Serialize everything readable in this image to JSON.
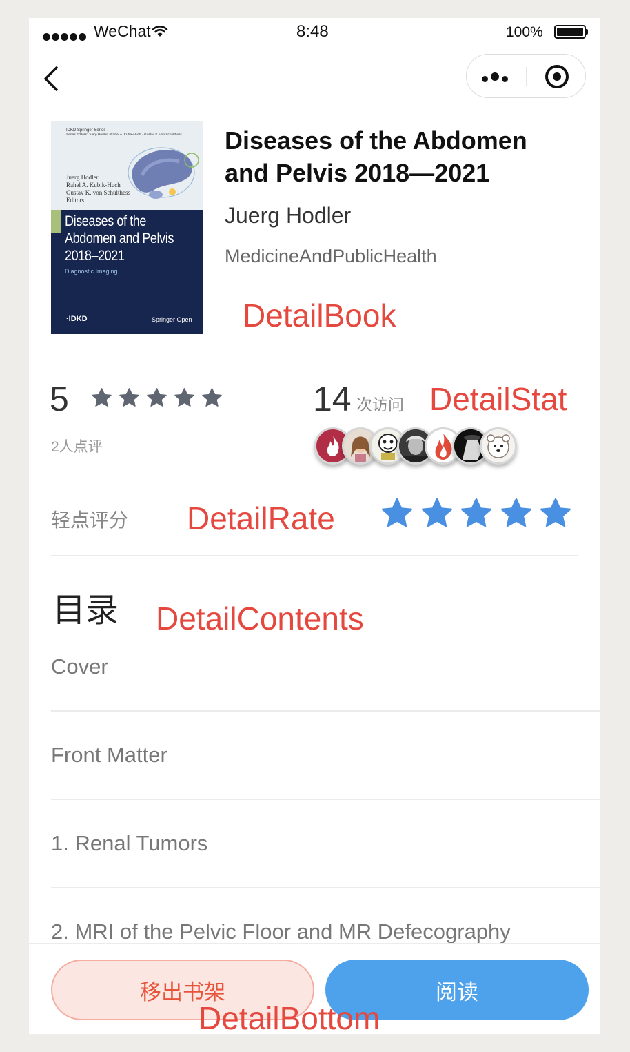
{
  "status_bar": {
    "carrier": "WeChat",
    "time": "8:48",
    "battery_percent": "100%"
  },
  "book": {
    "title_line1": "Diseases of the Abdomen",
    "title_line2": "and Pelvis 2018—2021",
    "author": "Juerg Hodler",
    "category": "MedicineAndPublicHealth",
    "cover": {
      "series": "IDKD Springer Series",
      "series_editors": "Series Editors: Juerg Hodler · Rahel A. Kubik-Huch · Gustav K. von Schulthess",
      "editors": [
        "Juerg Hodler",
        "Rahel A. Kubik-Huch",
        "Gustav K. von Schulthess",
        "Editors"
      ],
      "title_lines": [
        "Diseases of the",
        "Abdomen and Pelvis",
        "2018–2021"
      ],
      "subtitle": "Diagnostic Imaging",
      "badge": "·IDKD",
      "publisher": "Springer Open"
    }
  },
  "stat": {
    "score": "5",
    "rating_stars": 5,
    "reviewers": "2人点评",
    "visits": "14",
    "visits_label": "次访问",
    "avatar_count": 7
  },
  "rate": {
    "label": "轻点评分",
    "selected_stars": 5,
    "star_color": "#4a90e2"
  },
  "contents": {
    "title": "目录",
    "items": [
      "Cover",
      "Front Matter",
      "1. Renal Tumors",
      "2. MRI of the Pelvic Floor and MR Defecography"
    ]
  },
  "bottom": {
    "remove_label": "移出书架",
    "read_label": "阅读"
  },
  "annotations": {
    "book": "DetailBook",
    "stat": "DetailStat",
    "rate": "DetailRate",
    "contents": "DetailContents",
    "bottom": "DetailBottom"
  },
  "colors": {
    "annotation": "#e5483e",
    "read_button": "#4ea2ec",
    "remove_button_bg": "#fbe6e2",
    "remove_button_text": "#e8543b",
    "gray_star": "#5f6672",
    "cover_bg": "#17264e"
  },
  "icons": [
    "back-arrow-icon",
    "more-dots-icon",
    "target-icon",
    "wifi-icon",
    "battery-icon",
    "star-icon"
  ]
}
